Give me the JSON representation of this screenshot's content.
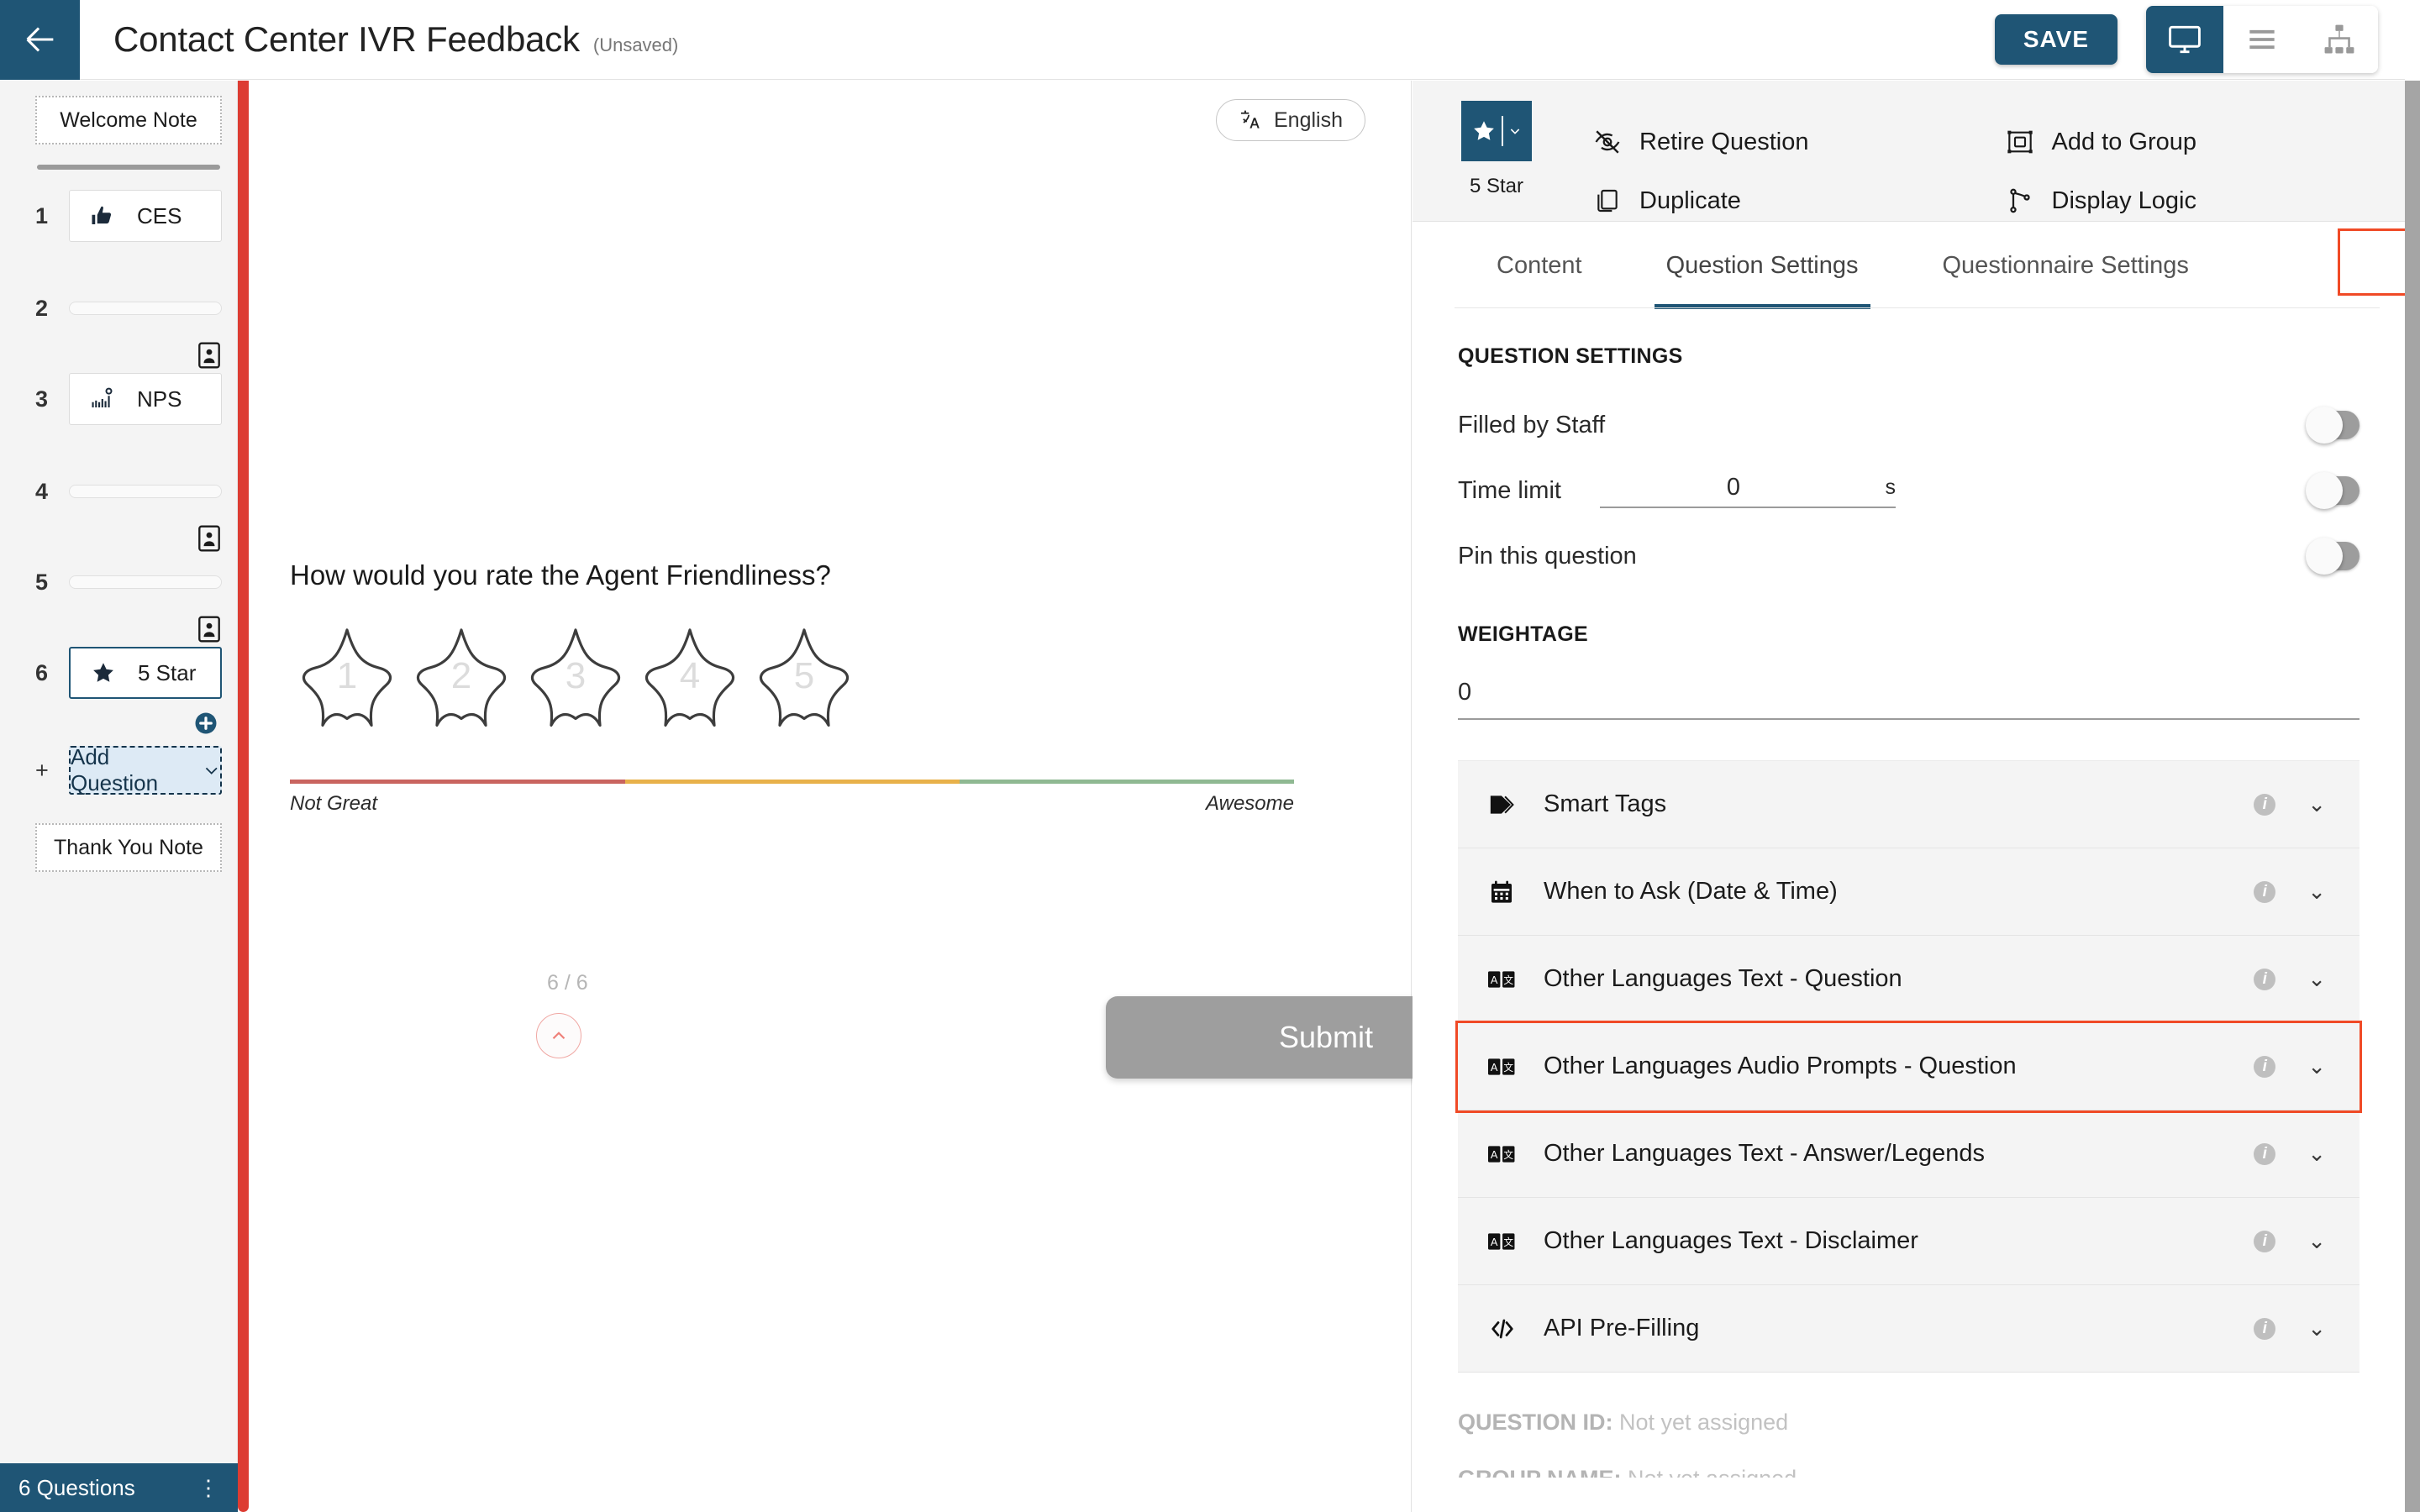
{
  "header": {
    "back_icon": "arrow-left-icon",
    "title": "Contact Center IVR Feedback",
    "unsaved_flag": "(Unsaved)",
    "save_label": "SAVE",
    "view_modes": [
      {
        "name": "desktop-preview",
        "icon": "monitor-icon",
        "active": true
      },
      {
        "name": "list-view",
        "icon": "hamburger-icon",
        "active": false
      },
      {
        "name": "tree-view",
        "icon": "sitemap-icon",
        "active": false
      }
    ]
  },
  "sidebar": {
    "welcome_note": "Welcome Note",
    "thank_you_note": "Thank You Note",
    "questions": [
      {
        "num": "1",
        "label": "CES",
        "icon": "thumbs-up-icon",
        "collapsed": false,
        "selected": false
      },
      {
        "num": "2",
        "label": "",
        "icon": "",
        "collapsed": true,
        "selected": false
      },
      {
        "num": "3",
        "label": "NPS",
        "icon": "nps-chart-icon",
        "collapsed": false,
        "selected": false
      },
      {
        "num": "4",
        "label": "",
        "icon": "",
        "collapsed": true,
        "selected": false
      },
      {
        "num": "5",
        "label": "",
        "icon": "",
        "collapsed": true,
        "selected": false
      },
      {
        "num": "6",
        "label": "5 Star",
        "icon": "star-icon",
        "collapsed": false,
        "selected": true
      }
    ],
    "add_question_num": "+",
    "add_question_label": "Add Question",
    "footer_count": "6 Questions",
    "footer_menu": "⋮"
  },
  "canvas": {
    "language_label": "English",
    "language_icon": "translate-icon",
    "question_text": "How would you rate the Agent Friendliness?",
    "star_values": [
      "1",
      "2",
      "3",
      "4",
      "5"
    ],
    "legend_left": "Not Great",
    "legend_right": "Awesome",
    "legend_colors": [
      "#c9645f",
      "#e8b14a",
      "#8fb992"
    ],
    "page_counter": "6 / 6",
    "scroll_up_icon": "chevron-up-icon",
    "submit_label": "Submit"
  },
  "right_panel": {
    "question_type_label": "5 Star",
    "question_type_icon": "star-icon",
    "actions": [
      {
        "label": "Retire Question",
        "icon": "eye-off-icon"
      },
      {
        "label": "Add to Group",
        "icon": "group-icon"
      },
      {
        "label": "Duplicate",
        "icon": "copy-icon"
      },
      {
        "label": "Display Logic",
        "icon": "branch-icon"
      }
    ],
    "tabs": [
      {
        "label": "Content",
        "active": false
      },
      {
        "label": "Question Settings",
        "active": true,
        "highlighted": true
      },
      {
        "label": "Questionnaire Settings",
        "active": false
      }
    ],
    "question_settings_title": "QUESTION SETTINGS",
    "settings": [
      {
        "label": "Filled by Staff",
        "toggle": "off"
      },
      {
        "label": "Time limit",
        "value": "0",
        "unit": "s",
        "toggle": "off"
      },
      {
        "label": "Pin this question",
        "toggle": "off"
      }
    ],
    "weightage_title": "WEIGHTAGE",
    "weightage_value": "0",
    "accordion": [
      {
        "label": "Smart Tags",
        "icon": "tag-icon",
        "highlighted": false
      },
      {
        "label": "When to Ask (Date & Time)",
        "icon": "calendar-icon",
        "highlighted": false
      },
      {
        "label": "Other Languages Text - Question",
        "icon": "translate-box-icon",
        "highlighted": false
      },
      {
        "label": "Other Languages Audio Prompts - Question",
        "icon": "translate-box-icon",
        "highlighted": true
      },
      {
        "label": "Other Languages Text - Answer/Legends",
        "icon": "translate-box-icon",
        "highlighted": false
      },
      {
        "label": "Other Languages Text - Disclaimer",
        "icon": "translate-box-icon",
        "highlighted": false
      },
      {
        "label": "API Pre-Filling",
        "icon": "code-icon",
        "highlighted": false
      }
    ],
    "info_icon_char": "i",
    "chevron_char": "⌄",
    "meta": [
      {
        "key": "QUESTION ID:",
        "value": " Not yet assigned"
      },
      {
        "key": "GROUP NAME:",
        "value": " Not yet assigned"
      }
    ]
  },
  "colors": {
    "brand_blue": "#1f5575",
    "accent_red": "#dd3c32",
    "highlight_orange": "#f04a26"
  }
}
